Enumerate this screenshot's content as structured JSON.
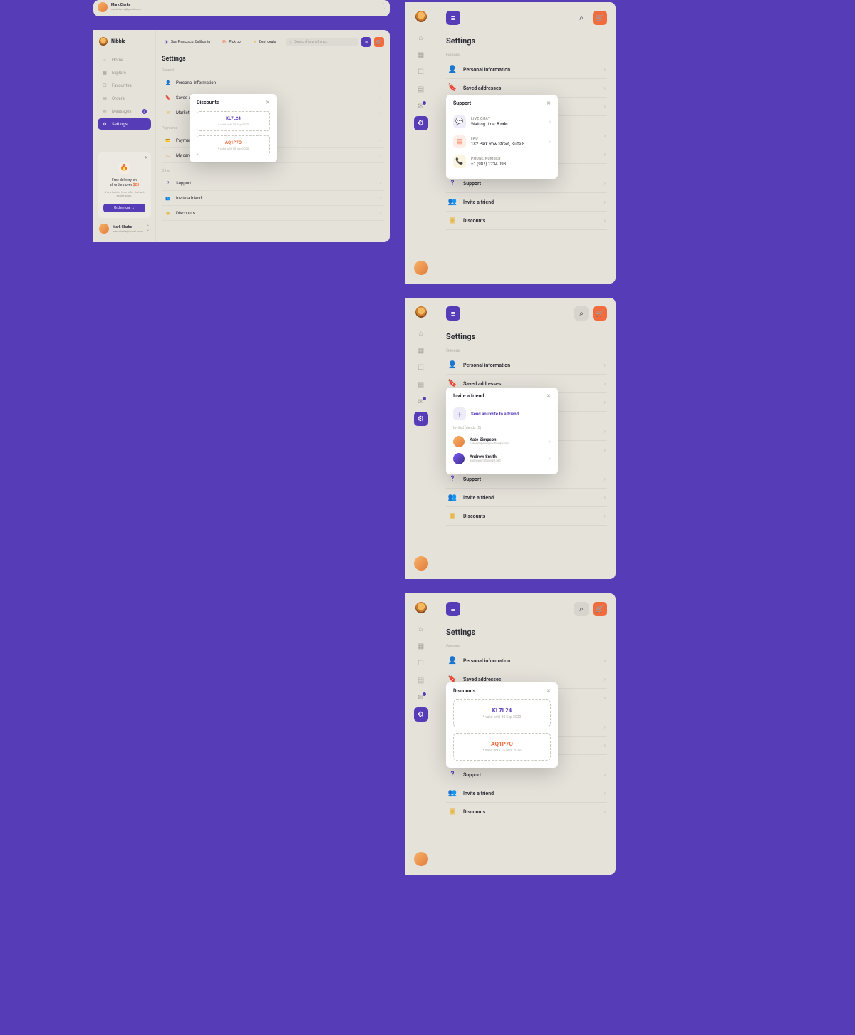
{
  "frame_top": {
    "user_name": "Mark Clarke",
    "user_email": "markclarke@gmail.com"
  },
  "frame_left": {
    "brand": "Nibble",
    "nav": {
      "home": "Home",
      "explore": "Explore",
      "favourites": "Favourites",
      "orders": "Orders",
      "messages": "Messages",
      "messages_badge": "3",
      "settings": "Settings"
    },
    "promo_line1": "Free delivery on",
    "promo_line2a": "all orders over ",
    "promo_line2b": "$25",
    "promo_sub": "It is a limited time offer that will expire soon.",
    "promo_btn": "Order now  →",
    "user_name": "Mark Clarke",
    "user_email": "markclarke@gmail.com",
    "topbar_location": "San Francisco, California",
    "topbar_pickup": "Pick up",
    "topbar_deals": "Best deals",
    "search_ph": "Search for anything...",
    "settings_title": "Settings",
    "sec_general": "General",
    "row_personal": "Personal information",
    "row_saved": "Saved addresses",
    "row_marketing": "Marketing preferences",
    "sec_payments": "Payments",
    "row_payment_methods": "Payment methods",
    "row_cards": "My cards",
    "sec_other": "Other",
    "row_support": "Support",
    "row_invite": "Invite a friend",
    "row_discounts": "Discounts",
    "popup_title": "Discounts",
    "code1": "KL7L24",
    "code1_sub": "* valid until 30 Sep 2020",
    "code2": "AQ1P7O",
    "code2_sub": "* valid until 15 Nov 2020"
  },
  "right": {
    "settings_title": "Settings",
    "sec_general": "General",
    "row_personal": "Personal information",
    "row_saved": "Saved addresses",
    "row_marketing": "Marketing preferences",
    "sec_payments": "Payments",
    "row_payment_methods": "Payment methods",
    "row_cards": "My cards",
    "sec_other": "Other",
    "row_support": "Support",
    "row_invite": "Invite a friend",
    "row_discounts": "Discounts"
  },
  "support_popup": {
    "title": "Support",
    "chat_label": "LIVE CHAT",
    "chat_value_a": "Waiting time: ",
    "chat_value_b": "5 min",
    "faq_label": "FAQ",
    "faq_value": "182 Park Row Street, Suite 8",
    "phone_label": "PHONE NUMBER",
    "phone_value": "+1 (987) 1234 098"
  },
  "invite_popup": {
    "title": "Invite a friend",
    "add": "Send an invite to a friend",
    "section": "Invited friends (2)",
    "f1_name": "Kate Simpson",
    "f1_mail": "katesimpson@outlook.com",
    "f2_name": "Andrew Smith",
    "f2_mail": "andrewsmith@ui8.net"
  },
  "discounts_popup": {
    "title": "Discounts",
    "code1": "KL7L24",
    "code1_sub": "* valid until 30 Sep 2020",
    "code2": "AQ1P7O",
    "code2_sub": "* valid until 15 Nov 2020"
  }
}
